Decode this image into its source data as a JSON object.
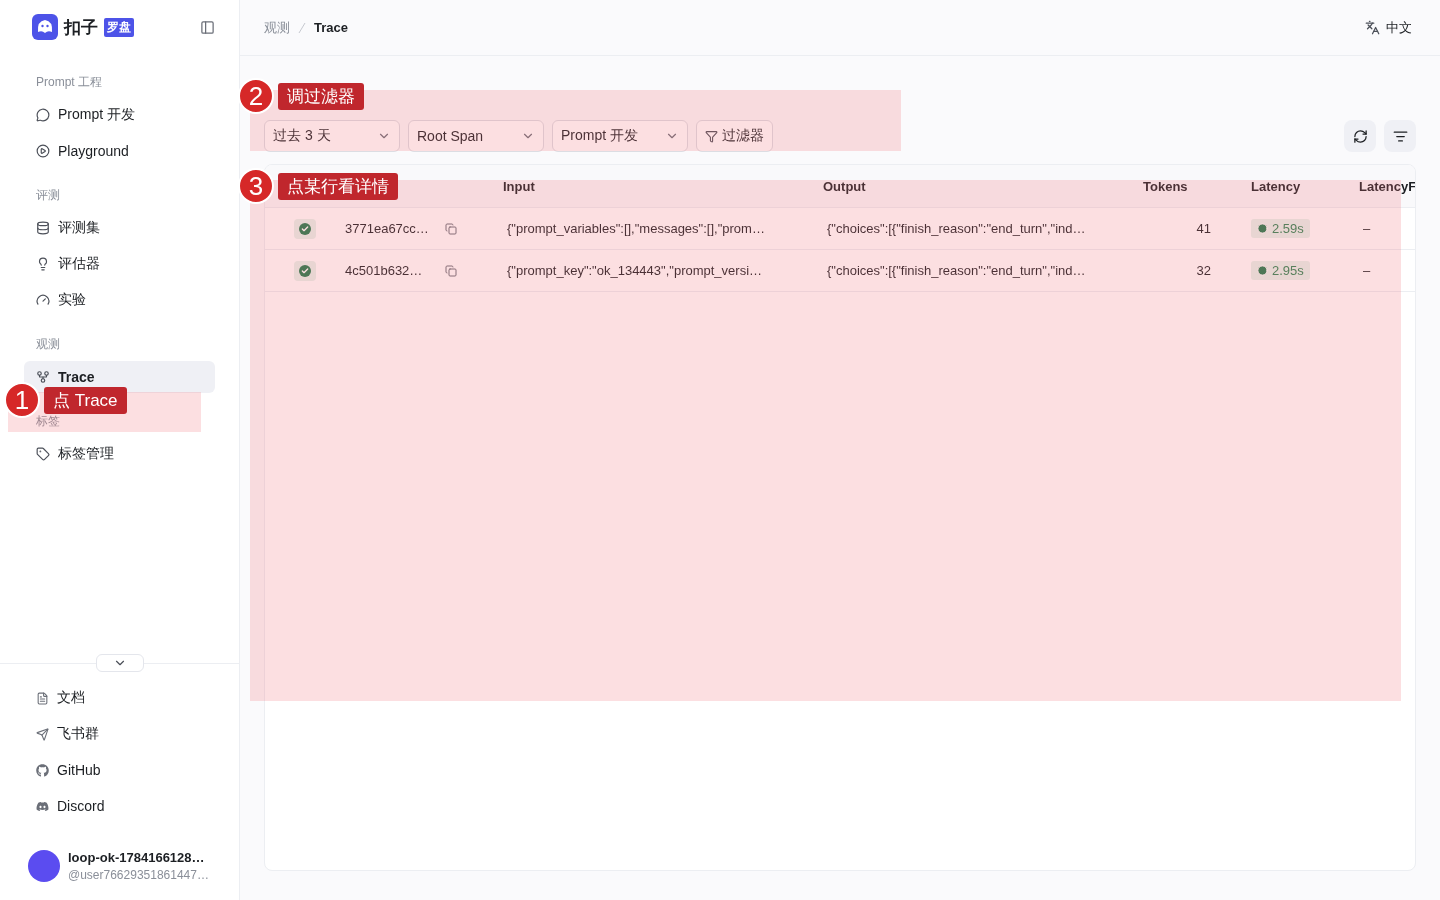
{
  "logo": {
    "text": "扣子",
    "badge": "罗盘"
  },
  "nav_sections": [
    {
      "heading": "Prompt 工程",
      "items": [
        {
          "label": "Prompt 开发",
          "selected": false
        },
        {
          "label": "Playground",
          "selected": false
        }
      ]
    },
    {
      "heading": "评测",
      "items": [
        {
          "label": "评测集",
          "selected": false
        },
        {
          "label": "评估器",
          "selected": false
        },
        {
          "label": "实验",
          "selected": false
        }
      ]
    },
    {
      "heading": "观测",
      "items": [
        {
          "label": "Trace",
          "selected": true
        }
      ]
    },
    {
      "heading": "标签",
      "items": [
        {
          "label": "标签管理",
          "selected": false
        }
      ]
    }
  ],
  "footer_links": [
    "文档",
    "飞书群",
    "GitHub",
    "Discord"
  ],
  "user": {
    "name": "loop-ok-1784166128…",
    "handle": "@user76629351861447…"
  },
  "breadcrumb": [
    "观测",
    "Trace"
  ],
  "language": "中文",
  "filters": [
    {
      "kind": "select",
      "label": "过去 3 天"
    },
    {
      "kind": "select",
      "label": "Root Span"
    },
    {
      "kind": "select",
      "label": "Prompt 开发"
    },
    {
      "kind": "button",
      "label": "过滤器"
    }
  ],
  "table": {
    "columns": [
      "Input",
      "Output",
      "Tokens",
      "Latency",
      "LatencyF"
    ],
    "rows": [
      {
        "success": true,
        "trace_id": "3771ea67cc…",
        "input": "{\"prompt_variables\":[],\"messages\":[],\"prom…",
        "output": "{\"choices\":[{\"finish_reason\":\"end_turn\",\"ind…",
        "tokens": "41",
        "latency": "2.59s",
        "latency_first": "–"
      },
      {
        "success": true,
        "trace_id": "4c501b632…",
        "input": "{\"prompt_key\":\"ok_134443\",\"prompt_versi…",
        "output": "{\"choices\":[{\"finish_reason\":\"end_turn\",\"ind…",
        "tokens": "32",
        "latency": "2.95s",
        "latency_first": "–"
      }
    ]
  },
  "annotations": [
    {
      "number": "1",
      "label": "点 Trace"
    },
    {
      "number": "2",
      "label": "调过滤器"
    },
    {
      "number": "3",
      "label": "点某行看详情"
    }
  ]
}
